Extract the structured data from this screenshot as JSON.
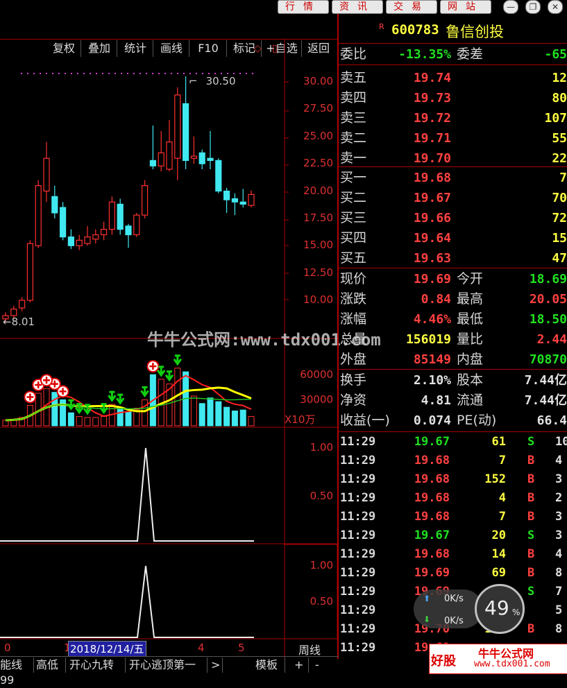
{
  "topbar": {
    "buttons": [
      "行情",
      "资讯",
      "交易",
      "网站"
    ],
    "window_controls": [
      "minimize",
      "restore",
      "close"
    ]
  },
  "toolbar": {
    "items": [
      "复权",
      "叠加",
      "统计",
      "画线",
      "F10",
      "标记",
      "+自选",
      "返回"
    ]
  },
  "stock": {
    "flag": "R",
    "code": "600783",
    "name": "鲁信创投"
  },
  "weibi": {
    "label": "委比",
    "value": "-13.35%",
    "label2": "委差",
    "value2": "-65"
  },
  "sell": [
    {
      "label": "卖五",
      "price": "19.74",
      "vol": "12"
    },
    {
      "label": "卖四",
      "price": "19.73",
      "vol": "80"
    },
    {
      "label": "卖三",
      "price": "19.72",
      "vol": "107"
    },
    {
      "label": "卖二",
      "price": "19.71",
      "vol": "55"
    },
    {
      "label": "卖一",
      "price": "19.70",
      "vol": "22"
    }
  ],
  "buy": [
    {
      "label": "买一",
      "price": "19.68",
      "vol": "7"
    },
    {
      "label": "买二",
      "price": "19.67",
      "vol": "70"
    },
    {
      "label": "买三",
      "price": "19.66",
      "vol": "72"
    },
    {
      "label": "买四",
      "price": "19.64",
      "vol": "15"
    },
    {
      "label": "买五",
      "price": "19.63",
      "vol": "47"
    }
  ],
  "quote": [
    {
      "l1": "现价",
      "v1": "19.69",
      "c1": "red",
      "l2": "今开",
      "v2": "18.69",
      "c2": "green"
    },
    {
      "l1": "涨跌",
      "v1": "0.84",
      "c1": "red",
      "l2": "最高",
      "v2": "20.05",
      "c2": "red"
    },
    {
      "l1": "涨幅",
      "v1": "4.46%",
      "c1": "red",
      "l2": "最低",
      "v2": "18.50",
      "c2": "green"
    },
    {
      "l1": "总量",
      "v1": "156019",
      "c1": "yellow",
      "l2": "量比",
      "v2": "2.44",
      "c2": "red"
    },
    {
      "l1": "外盘",
      "v1": "85149",
      "c1": "red",
      "l2": "内盘",
      "v2": "70870",
      "c2": "green"
    }
  ],
  "stats": [
    {
      "l1": "换手",
      "v1": "2.10%",
      "l2": "股本",
      "v2": "7.44亿"
    },
    {
      "l1": "净资",
      "v1": "4.81",
      "l2": "流通",
      "v2": "7.44亿"
    },
    {
      "l1": "收益(一)",
      "v1": "0.074",
      "l2": "PE(动)",
      "v2": "66.4"
    }
  ],
  "ticks": [
    {
      "time": "11:29",
      "price": "19.67",
      "pc": "green",
      "vol": "61",
      "dir": "S",
      "dc": "green",
      "n": "10"
    },
    {
      "time": "11:29",
      "price": "19.68",
      "pc": "red",
      "vol": "7",
      "dir": "B",
      "dc": "red",
      "n": "4"
    },
    {
      "time": "11:29",
      "price": "19.68",
      "pc": "red",
      "vol": "152",
      "dir": "B",
      "dc": "red",
      "n": "3"
    },
    {
      "time": "11:29",
      "price": "19.68",
      "pc": "red",
      "vol": "4",
      "dir": "B",
      "dc": "red",
      "n": "2"
    },
    {
      "time": "11:29",
      "price": "19.68",
      "pc": "red",
      "vol": "7",
      "dir": "B",
      "dc": "red",
      "n": "3"
    },
    {
      "time": "11:29",
      "price": "19.67",
      "pc": "green",
      "vol": "20",
      "dir": "S",
      "dc": "green",
      "n": "3"
    },
    {
      "time": "11:29",
      "price": "19.68",
      "pc": "red",
      "vol": "14",
      "dir": "B",
      "dc": "red",
      "n": "4"
    },
    {
      "time": "11:29",
      "price": "19.69",
      "pc": "red",
      "vol": "69",
      "dir": "B",
      "dc": "red",
      "n": "8"
    },
    {
      "time": "11:29",
      "price": "19.69",
      "pc": "red",
      "vol": "11",
      "dir": "S",
      "dc": "green",
      "n": "7"
    },
    {
      "time": "11:29",
      "price": "",
      "pc": "red",
      "vol": "",
      "dir": "",
      "dc": "red",
      "n": "5"
    },
    {
      "time": "11:29",
      "price": "19.70",
      "pc": "red",
      "vol": "107",
      "dir": "B",
      "dc": "red",
      "n": "8"
    },
    {
      "time": "11:29",
      "price": "19.69",
      "pc": "red",
      "vol": "",
      "dir": "",
      "dc": "red",
      "n": ""
    }
  ],
  "chart": {
    "price_axis": [
      "30.00",
      "27.50",
      "25.00",
      "22.50",
      "20.00",
      "17.50",
      "15.00",
      "12.50",
      "10.00"
    ],
    "max_label": "30.50",
    "min_label": "8.01",
    "vol_axis": [
      "60000",
      "30000"
    ],
    "vol_unit": "X10万",
    "ind1_axis": [
      "1.00",
      "0.50"
    ],
    "ind2_axis": [
      "1.00",
      "0.50"
    ],
    "date_label": "2018/12/14/五",
    "x_ticks": [
      "0",
      "1",
      "4",
      "5"
    ],
    "period": "周线"
  },
  "chart_data": {
    "type": "candlestick",
    "ylim": [
      8.0,
      31.5
    ],
    "candles": [
      {
        "o": 8.3,
        "c": 8.6,
        "h": 8.9,
        "l": 8.01
      },
      {
        "o": 8.6,
        "c": 9.2,
        "h": 9.5,
        "l": 8.3
      },
      {
        "o": 9.3,
        "c": 10.0,
        "h": 10.3,
        "l": 9.0
      },
      {
        "o": 10.0,
        "c": 15.2,
        "h": 15.5,
        "l": 9.8
      },
      {
        "o": 15.0,
        "c": 20.5,
        "h": 21.0,
        "l": 14.8
      },
      {
        "o": 20.0,
        "c": 23.0,
        "h": 24.5,
        "l": 19.0
      },
      {
        "o": 19.5,
        "c": 18.0,
        "h": 20.5,
        "l": 17.5
      },
      {
        "o": 18.5,
        "c": 15.8,
        "h": 19.0,
        "l": 15.5
      },
      {
        "o": 15.8,
        "c": 15.0,
        "h": 16.5,
        "l": 14.7
      },
      {
        "o": 15.0,
        "c": 15.5,
        "h": 16.0,
        "l": 14.6
      },
      {
        "o": 15.2,
        "c": 15.8,
        "h": 16.8,
        "l": 15.0
      },
      {
        "o": 15.6,
        "c": 16.0,
        "h": 16.5,
        "l": 15.2
      },
      {
        "o": 16.0,
        "c": 16.5,
        "h": 17.2,
        "l": 15.5
      },
      {
        "o": 16.5,
        "c": 19.0,
        "h": 19.5,
        "l": 16.0
      },
      {
        "o": 18.8,
        "c": 16.5,
        "h": 19.3,
        "l": 16.0
      },
      {
        "o": 16.8,
        "c": 16.0,
        "h": 17.0,
        "l": 14.8
      },
      {
        "o": 16.0,
        "c": 17.8,
        "h": 18.0,
        "l": 15.8
      },
      {
        "o": 17.8,
        "c": 20.5,
        "h": 21.0,
        "l": 17.5
      },
      {
        "o": 22.8,
        "c": 22.3,
        "h": 26.0,
        "l": 22.0
      },
      {
        "o": 22.3,
        "c": 23.5,
        "h": 25.5,
        "l": 21.8
      },
      {
        "o": 22.0,
        "c": 24.5,
        "h": 26.5,
        "l": 21.8
      },
      {
        "o": 23.0,
        "c": 28.8,
        "h": 29.5,
        "l": 21.0
      },
      {
        "o": 28.0,
        "c": 22.8,
        "h": 30.5,
        "l": 22.0
      },
      {
        "o": 23.0,
        "c": 23.2,
        "h": 25.0,
        "l": 22.5
      },
      {
        "o": 23.5,
        "c": 22.5,
        "h": 23.8,
        "l": 22.0
      },
      {
        "o": 23.0,
        "c": 22.8,
        "h": 25.5,
        "l": 22.0
      },
      {
        "o": 22.8,
        "c": 20.0,
        "h": 23.0,
        "l": 19.8
      },
      {
        "o": 20.0,
        "c": 19.2,
        "h": 20.3,
        "l": 18.0
      },
      {
        "o": 19.3,
        "c": 19.0,
        "h": 19.8,
        "l": 17.8
      },
      {
        "o": 19.0,
        "c": 18.8,
        "h": 20.2,
        "l": 18.5
      },
      {
        "o": 18.69,
        "c": 19.69,
        "h": 20.05,
        "l": 18.5
      }
    ],
    "volumes": [
      6000,
      7000,
      9000,
      22000,
      35000,
      40000,
      36000,
      28000,
      14000,
      10000,
      9000,
      9000,
      10000,
      23000,
      20000,
      15000,
      19000,
      28000,
      55000,
      50000,
      45000,
      62000,
      58000,
      32000,
      24000,
      30000,
      26000,
      20000,
      16000,
      17000,
      10000
    ]
  },
  "bottombar": {
    "items": [
      "能线99",
      "高低",
      "开心九转",
      "开心逃顶第一",
      ">",
      "模板",
      "+",
      "-"
    ]
  },
  "watermark": "牛牛公式网:www.tdx001.com",
  "net": {
    "up": "0K/s",
    "down": "0K/s",
    "percent": "49"
  },
  "logo_text": "牛牛公式网",
  "logo_url": "www.tdx001.com",
  "logo_left": "好股"
}
